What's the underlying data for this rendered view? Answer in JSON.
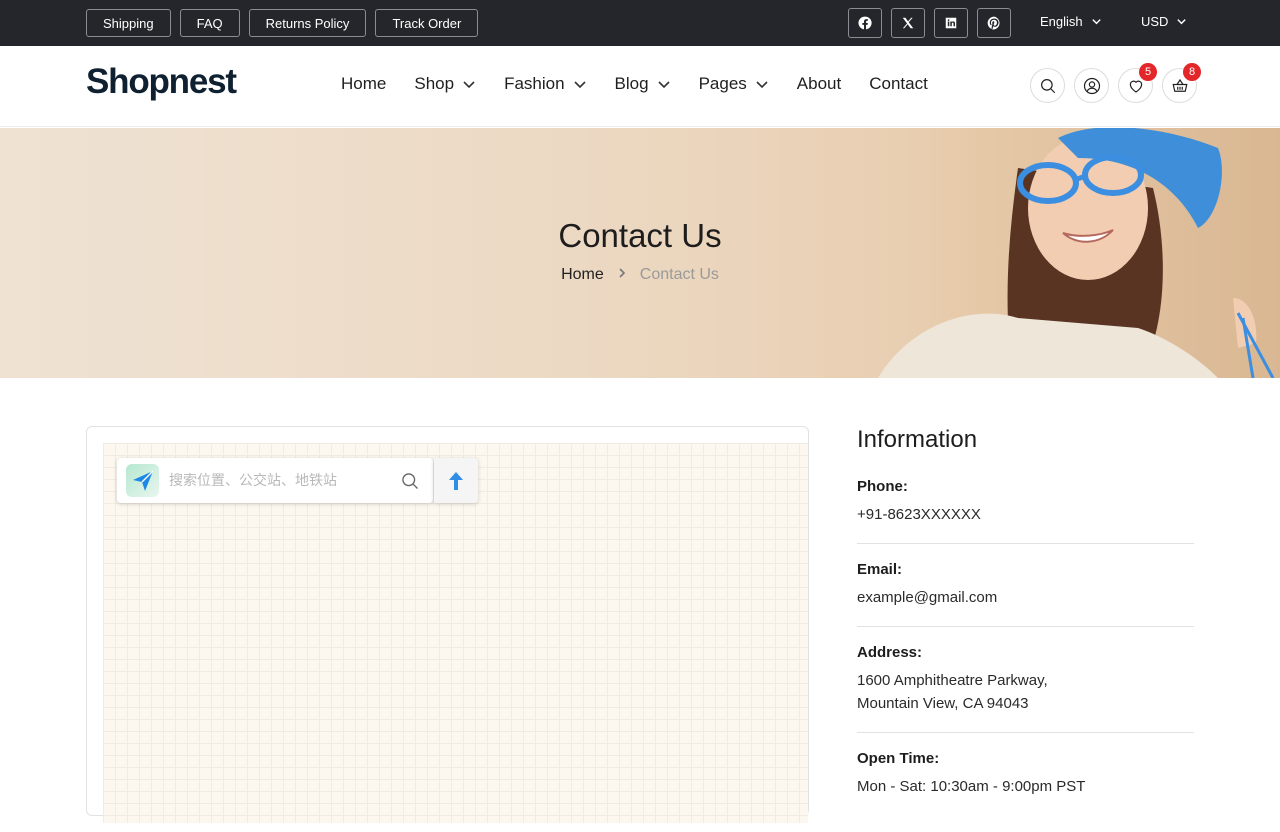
{
  "topbar": {
    "links": [
      "Shipping",
      "FAQ",
      "Returns Policy",
      "Track Order"
    ],
    "social": [
      "facebook-icon",
      "x-icon",
      "linkedin-icon",
      "pinterest-icon"
    ],
    "language": "English",
    "currency": "USD"
  },
  "header": {
    "logo": "Shopnest",
    "nav": [
      {
        "label": "Home",
        "dropdown": false
      },
      {
        "label": "Shop",
        "dropdown": true
      },
      {
        "label": "Fashion",
        "dropdown": true
      },
      {
        "label": "Blog",
        "dropdown": true
      },
      {
        "label": "Pages",
        "dropdown": true
      },
      {
        "label": "About",
        "dropdown": false
      },
      {
        "label": "Contact",
        "dropdown": false
      }
    ],
    "wishlist_count": "5",
    "cart_count": "8"
  },
  "hero": {
    "title": "Contact Us",
    "breadcrumb_home": "Home",
    "breadcrumb_current": "Contact Us"
  },
  "map": {
    "search_placeholder": "搜索位置、公交站、地铁站"
  },
  "info": {
    "title": "Information",
    "phone_label": "Phone:",
    "phone": "+91-8623XXXXXX",
    "email_label": "Email:",
    "email": "example@gmail.com",
    "address_label": "Address:",
    "address_line1": "1600 Amphitheatre Parkway,",
    "address_line2": "Mountain View, CA 94043",
    "hours_label": "Open Time:",
    "hours": "Mon - Sat: 10:30am - 9:00pm PST"
  },
  "colors": {
    "topbar_bg": "#24262b",
    "badge": "#e3262a",
    "logo": "#0f2030"
  }
}
